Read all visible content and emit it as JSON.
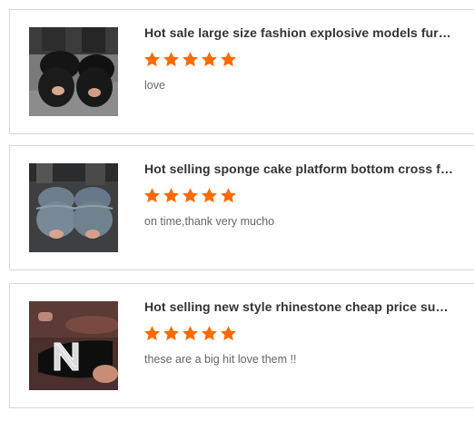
{
  "reviews": [
    {
      "title": "Hot sale large size fashion explosive models furry slippers women",
      "rating": 5,
      "text": "love",
      "image_icon": "black-furry-slipper-photo"
    },
    {
      "title": "Hot selling sponge cake platform bottom cross furry slippers",
      "rating": 5,
      "text": "on time,thank very mucho",
      "image_icon": "grey-furry-slipper-photo"
    },
    {
      "title": "Hot selling new style rhinestone cheap price summer slippers",
      "rating": 5,
      "text": "these are a big hit love them !!",
      "image_icon": "rhinestone-slipper-photo"
    }
  ],
  "colors": {
    "star": "#ff6a00",
    "title": "#333333",
    "review_text": "#666666",
    "border": "#d8d8d8"
  }
}
